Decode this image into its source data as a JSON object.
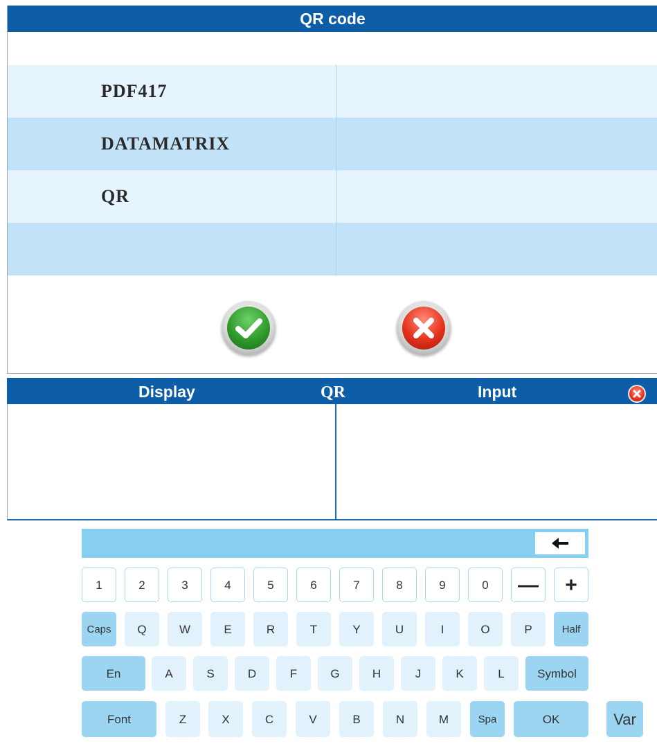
{
  "dialog": {
    "title": "QR code",
    "options": [
      "PDF417",
      "DATAMATRIX",
      "QR",
      ""
    ],
    "ok_icon": "check-icon",
    "cancel_icon": "x-icon"
  },
  "panel": {
    "display_label": "Display",
    "mode_label": "QR",
    "input_label": "Input",
    "close_icon": "close-icon"
  },
  "keyboard": {
    "backspace_icon": "arrow-left-icon",
    "row1": [
      "1",
      "2",
      "3",
      "4",
      "5",
      "6",
      "7",
      "8",
      "9",
      "0",
      "—",
      "+"
    ],
    "row2": [
      "Caps",
      "Q",
      "W",
      "E",
      "R",
      "T",
      "Y",
      "U",
      "I",
      "O",
      "P",
      "Half"
    ],
    "row3": [
      "En",
      "A",
      "S",
      "D",
      "F",
      "G",
      "H",
      "J",
      "K",
      "L",
      "Symbol"
    ],
    "row4": [
      "Font",
      "Z",
      "X",
      "C",
      "V",
      "B",
      "N",
      "M",
      "Spa",
      "OK",
      "Var"
    ]
  },
  "colors": {
    "title_bar": "#0d5ea6",
    "row_light": "#e6f4fd",
    "row_dark": "#c2e3f7",
    "key_blue": "#9cd5f2",
    "key_pale": "#e1f2fc"
  }
}
